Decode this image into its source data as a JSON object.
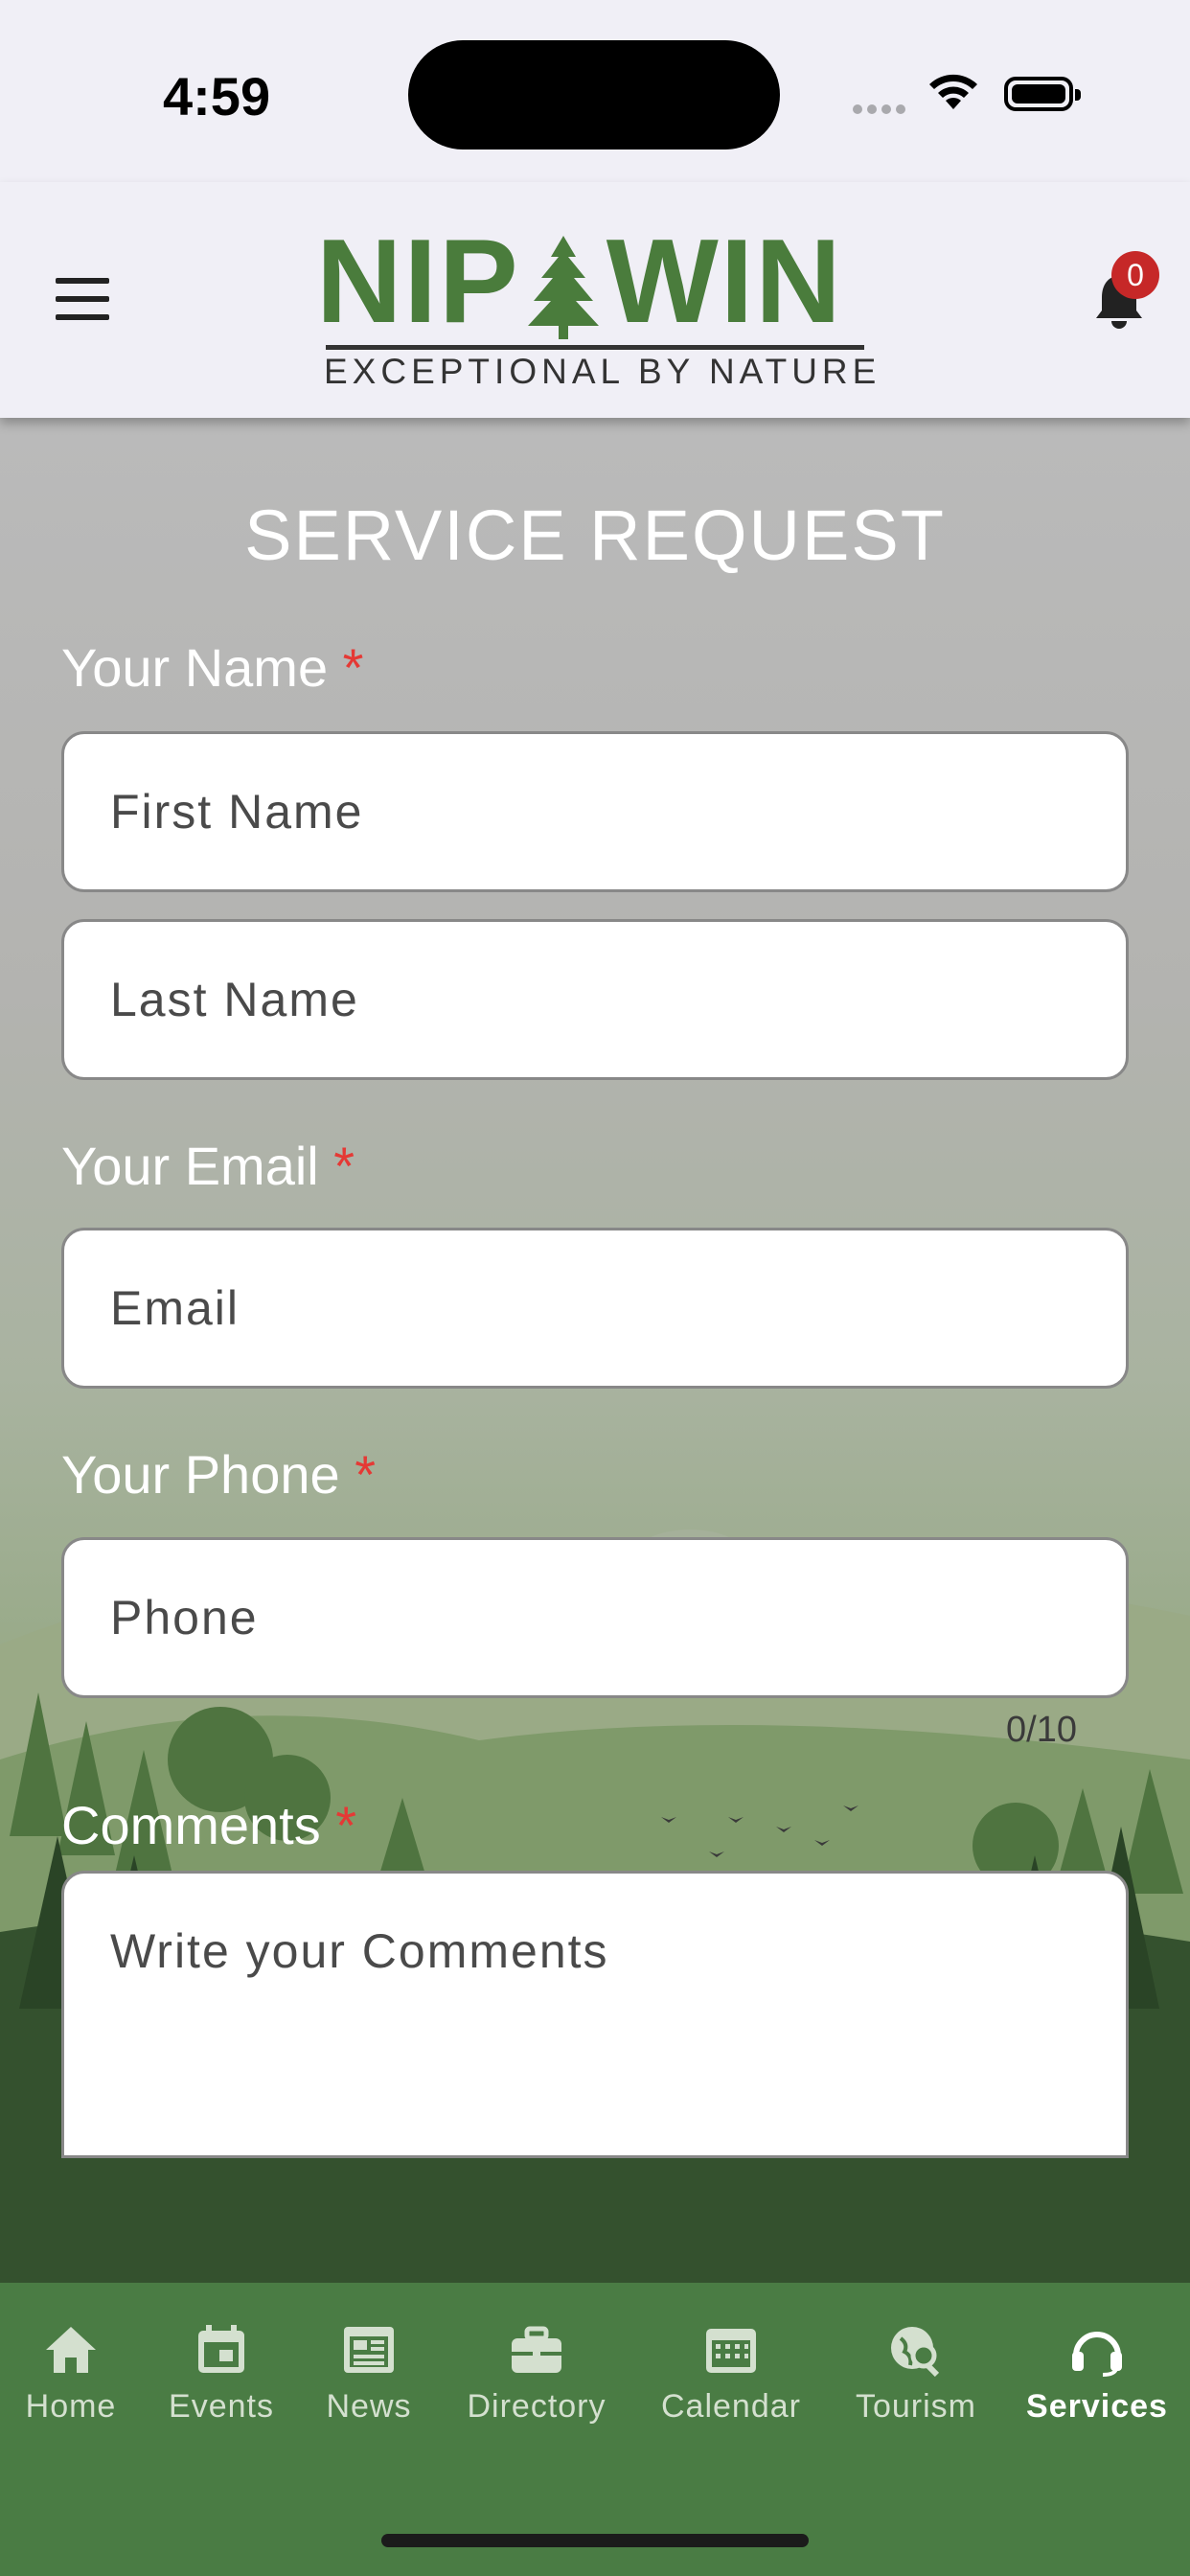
{
  "status_bar": {
    "time": "4:59"
  },
  "header": {
    "logo": {
      "wordmark_left": "NIP",
      "wordmark_right": "WIN",
      "tagline": "EXCEPTIONAL BY NATURE"
    },
    "notification_count": "0"
  },
  "form": {
    "title": "SERVICE REQUEST",
    "required_mark": "*",
    "name_label": "Your Name",
    "first_name_placeholder": "First Name",
    "last_name_placeholder": "Last Name",
    "email_label": "Your Email",
    "email_placeholder": "Email",
    "phone_label": "Your Phone",
    "phone_placeholder": "Phone",
    "phone_counter": "0/10",
    "comments_label": "Comments",
    "comments_placeholder": "Write your Comments"
  },
  "tabbar": {
    "active": "Services",
    "active_color": "#ffffff",
    "inactive_color": "#d4e0cf",
    "background": "#4a7c44",
    "items": [
      {
        "label": "Home",
        "icon": "home-icon"
      },
      {
        "label": "Events",
        "icon": "calendar-event-icon"
      },
      {
        "label": "News",
        "icon": "newspaper-icon"
      },
      {
        "label": "Directory",
        "icon": "briefcase-icon"
      },
      {
        "label": "Calendar",
        "icon": "calendar-grid-icon"
      },
      {
        "label": "Tourism",
        "icon": "globe-search-icon"
      },
      {
        "label": "Services",
        "icon": "headset-icon"
      }
    ]
  },
  "colors": {
    "brand_green": "#4a7c3c",
    "required": "#e53935",
    "badge": "#c62828"
  }
}
